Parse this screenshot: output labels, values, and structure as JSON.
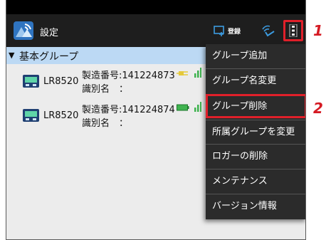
{
  "app": {
    "title": "設定",
    "register_label": "登録",
    "icon": "app-logo-icon",
    "accent_color": "#e0202a"
  },
  "group": {
    "arrow": "▼",
    "name": "基本グループ"
  },
  "devices": [
    {
      "model": "LR8520",
      "serial": "製造番号:141224873",
      "ident": "識別名　：",
      "battery_icon": "usb-power-icon"
    },
    {
      "model": "LR8520",
      "serial": "製造番号:141224874",
      "ident": "識別名　：",
      "battery_icon": "battery-full-icon"
    }
  ],
  "menu": {
    "items": [
      {
        "label": "グループ追加"
      },
      {
        "label": "グループ名変更"
      },
      {
        "label": "グループ削除"
      },
      {
        "label": "所属グループを変更"
      },
      {
        "label": "ロガーの削除"
      },
      {
        "label": "メンテナンス"
      },
      {
        "label": "バージョン情報"
      }
    ]
  },
  "callouts": {
    "one": "1",
    "two": "2"
  }
}
